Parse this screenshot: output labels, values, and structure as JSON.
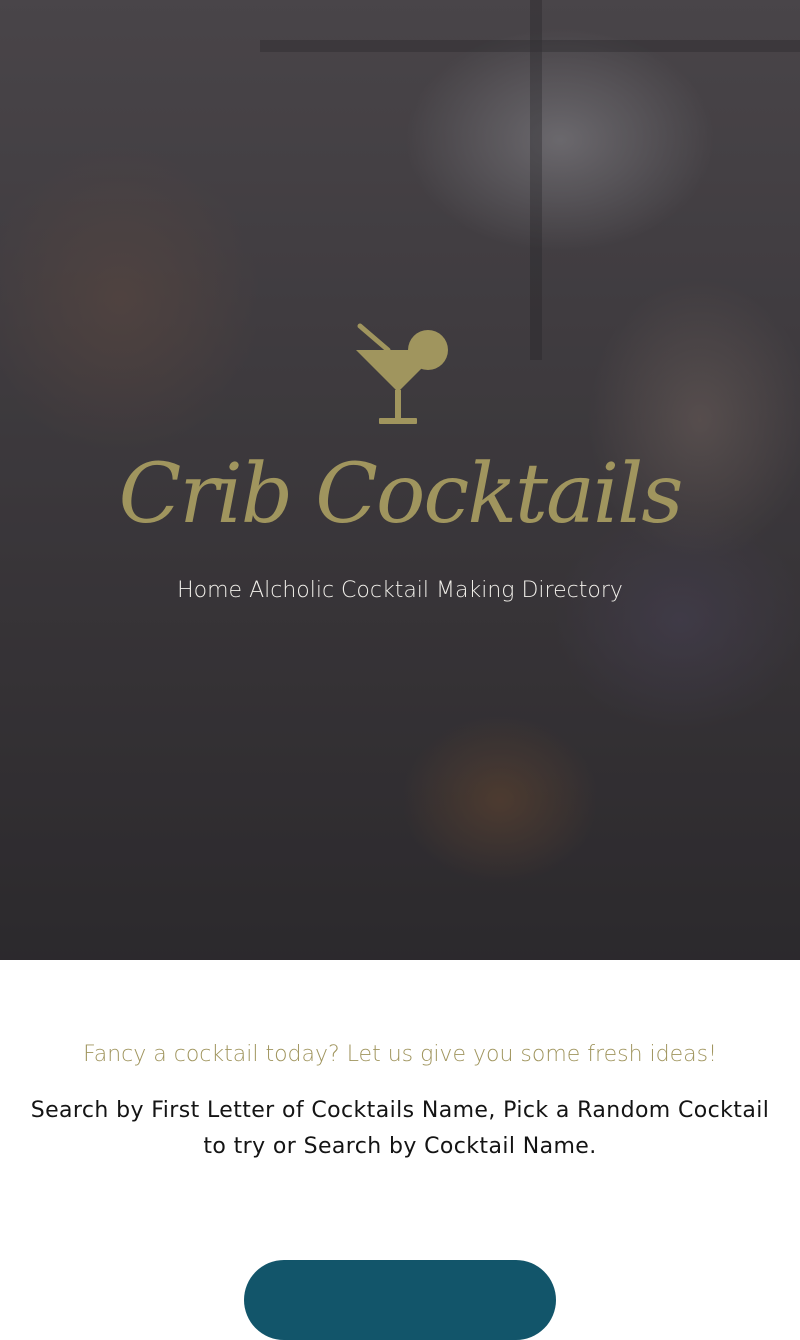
{
  "hero": {
    "logo_icon": "cocktail-glass-icon",
    "brand_name": "Crib Cocktails",
    "tagline": "Home Alcholic Cocktail Making Directory"
  },
  "intro": {
    "lead": "Fancy a cocktail today? Let us give you some fresh ideas!",
    "body": "Search by First Letter of Cocktails Name, Pick a Random Cocktail to try or Search by Cocktail Name."
  },
  "cta": {
    "label": ""
  },
  "colors": {
    "gold": "#a0955e",
    "teal": "#12556a",
    "text_dark": "#141414"
  }
}
